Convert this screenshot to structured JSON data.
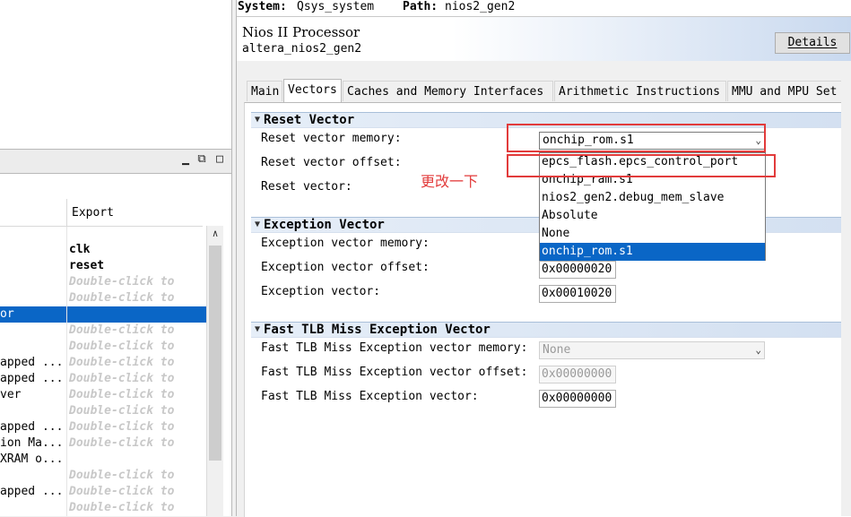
{
  "system_bar": {
    "system_label": "System:",
    "system_value": "Qsys_system",
    "path_label": "Path:",
    "path_value": "nios2_gen2"
  },
  "component": {
    "title": "Nios II Processor",
    "subtitle": "altera_nios2_gen2",
    "details_label": "Details"
  },
  "tabs": [
    {
      "label": "Main"
    },
    {
      "label": "Vectors",
      "active": true
    },
    {
      "label": "Caches and Memory Interfaces"
    },
    {
      "label": "Arithmetic Instructions"
    },
    {
      "label": "MMU and MPU Set"
    }
  ],
  "reset_vector": {
    "title": "Reset Vector",
    "memory_label": "Reset vector memory:",
    "memory_value": "onchip_rom.s1",
    "offset_label": "Reset vector offset:",
    "vector_label": "Reset vector:"
  },
  "dropdown": {
    "options": [
      "epcs_flash.epcs_control_port",
      "onchip_ram.s1",
      "nios2_gen2.debug_mem_slave",
      "Absolute",
      "None",
      "onchip_rom.s1"
    ],
    "selected": "onchip_rom.s1"
  },
  "exception_vector": {
    "title": "Exception Vector",
    "memory_label": "Exception vector memory:",
    "offset_label": "Exception vector offset:",
    "offset_value": "0x00000020",
    "vector_label": "Exception vector:",
    "vector_value": "0x00010020"
  },
  "fast_tlb": {
    "title": "Fast TLB Miss Exception Vector",
    "memory_label": "Fast TLB Miss Exception vector memory:",
    "memory_value": "None",
    "offset_label": "Fast TLB Miss Exception vector offset:",
    "offset_value": "0x00000000",
    "vector_label": "Fast TLB Miss Exception vector:",
    "vector_value": "0x00000000"
  },
  "annotation": {
    "text": "更改一下",
    "color": "#e23b3b"
  },
  "left_panel": {
    "export_header": "Export",
    "rows": [
      {
        "name": "",
        "export": "clk",
        "style": "bold"
      },
      {
        "name": "",
        "export": "reset",
        "style": "bold"
      },
      {
        "name": "",
        "export": "Double-click to",
        "style": "hint"
      },
      {
        "name": "",
        "export": "Double-click to",
        "style": "hint"
      },
      {
        "name": "or",
        "export": "",
        "style": "selected"
      },
      {
        "name": "",
        "export": "Double-click to",
        "style": "hint"
      },
      {
        "name": "",
        "export": "Double-click to",
        "style": "hint"
      },
      {
        "name": "apped ...",
        "export": "Double-click to",
        "style": "hint"
      },
      {
        "name": "apped ...",
        "export": "Double-click to",
        "style": "hint"
      },
      {
        "name": "ver",
        "export": "Double-click to",
        "style": "hint"
      },
      {
        "name": "",
        "export": "Double-click to",
        "style": "hint"
      },
      {
        "name": "apped ...",
        "export": "Double-click to",
        "style": "hint"
      },
      {
        "name": "ion Ma...",
        "export": "Double-click to",
        "style": "hint"
      },
      {
        "name": "XRAM o...",
        "export": "",
        "style": "plain"
      },
      {
        "name": "",
        "export": "Double-click to",
        "style": "hint"
      },
      {
        "name": "apped ...",
        "export": "Double-click to",
        "style": "hint"
      },
      {
        "name": "",
        "export": "Double-click to",
        "style": "hint"
      }
    ]
  },
  "colors": {
    "selection": "#0a66c6",
    "annotation_red": "#e23b3b",
    "section_bar": "#d3e0f1"
  }
}
